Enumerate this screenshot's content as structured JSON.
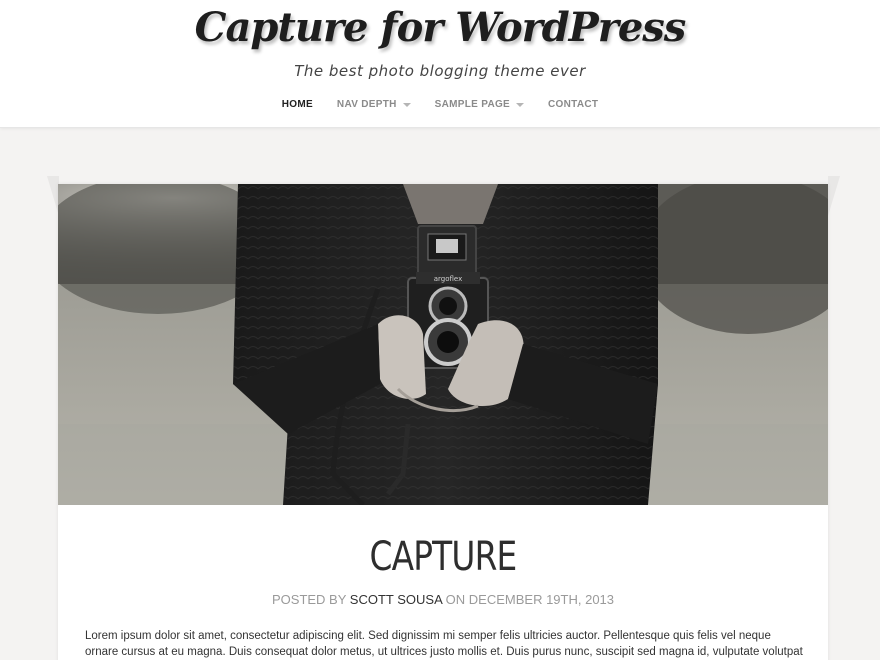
{
  "site": {
    "title": "Capture for WordPress",
    "tagline": "The best photo blogging theme ever"
  },
  "nav": {
    "items": [
      {
        "label": "HOME",
        "active": true,
        "has_dropdown": false
      },
      {
        "label": "NAV DEPTH",
        "active": false,
        "has_dropdown": true
      },
      {
        "label": "SAMPLE PAGE",
        "active": false,
        "has_dropdown": true
      },
      {
        "label": "CONTACT",
        "active": false,
        "has_dropdown": false
      }
    ]
  },
  "post": {
    "title": "CAPTURE",
    "byline_prefix": "POSTED BY",
    "author": "SCOTT SOUSA",
    "byline_on": "ON",
    "date": "DECEMBER 19TH, 2013",
    "camera_brand": "argoflex",
    "excerpt": "Lorem ipsum dolor sit amet, consectetur adipiscing elit. Sed dignissim mi semper felis ultricies auctor. Pellentesque quis felis vel neque ornare cursus at eu magna. Duis consequat dolor metus, ut ultrices justo mollis et. Duis purus nunc, suscipit sed magna id, vulputate volutpat urna. Nunc"
  },
  "colors": {
    "background": "#f4f3f2",
    "header_bg": "#ffffff",
    "title_text": "#1e1e1e",
    "nav_active": "#222222",
    "nav_inactive": "#8a8a8a",
    "meta_text": "#9a9a9a"
  }
}
